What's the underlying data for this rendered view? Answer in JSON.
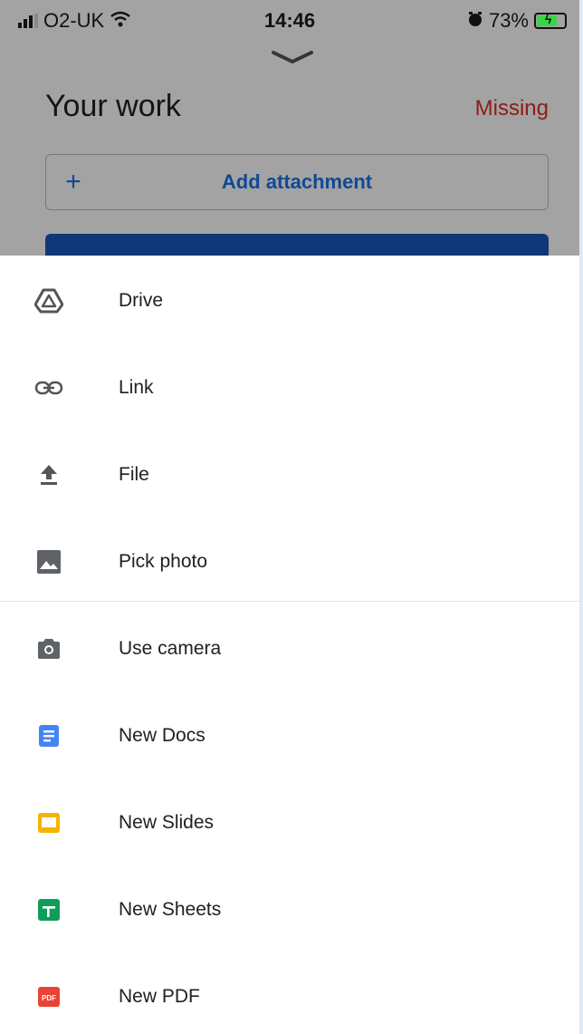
{
  "status_bar": {
    "carrier": "O2-UK",
    "time": "14:46",
    "battery": "73%",
    "battery_level": 0.73
  },
  "header": {
    "title": "Your work",
    "status": "Missing"
  },
  "attachment": {
    "add_label": "Add attachment"
  },
  "menu": {
    "items": [
      {
        "label": "Drive",
        "icon": "drive-icon"
      },
      {
        "label": "Link",
        "icon": "link-icon"
      },
      {
        "label": "File",
        "icon": "upload-icon"
      },
      {
        "label": "Pick photo",
        "icon": "photo-icon"
      },
      {
        "label": "Use camera",
        "icon": "camera-icon"
      },
      {
        "label": "New Docs",
        "icon": "docs-icon",
        "color": "#4285f4"
      },
      {
        "label": "New Slides",
        "icon": "slides-icon",
        "color": "#f4b400"
      },
      {
        "label": "New Sheets",
        "icon": "sheets-icon",
        "color": "#0f9d58"
      },
      {
        "label": "New PDF",
        "icon": "pdf-icon",
        "color": "#ea4335",
        "badge": "PDF"
      }
    ]
  },
  "colors": {
    "accent": "#1a73e8",
    "missing": "#d93025",
    "dim": "rgba(0,0,0,0.36)"
  }
}
